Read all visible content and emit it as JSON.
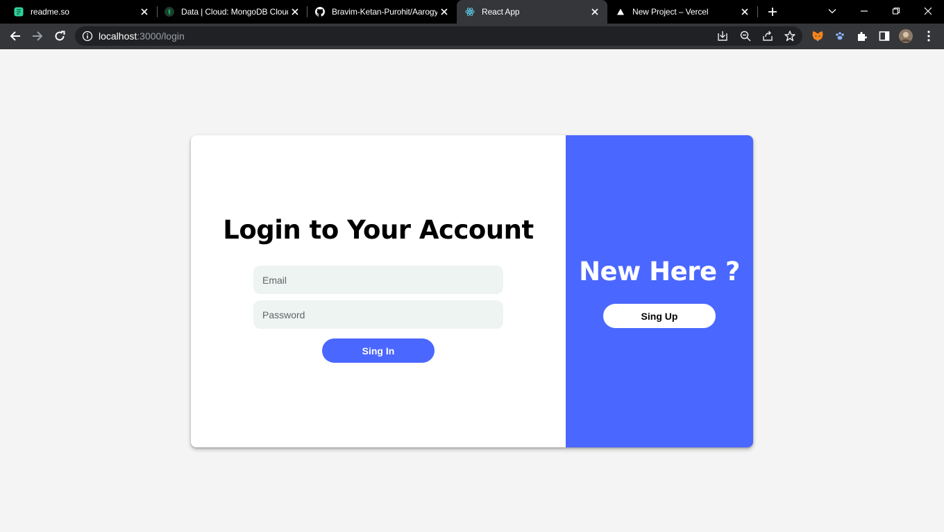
{
  "browser": {
    "tabs": [
      {
        "title": "readme.so",
        "favicon": "readme-so-icon",
        "active": false
      },
      {
        "title": "Data | Cloud: MongoDB Cloud",
        "favicon": "mongodb-leaf-icon",
        "active": false
      },
      {
        "title": "Bravim-Ketan-Purohit/Aarogya",
        "favicon": "github-icon",
        "active": false
      },
      {
        "title": "React App",
        "favicon": "react-icon",
        "active": true
      },
      {
        "title": "New Project – Vercel",
        "favicon": "vercel-triangle-icon",
        "active": false
      }
    ],
    "address": {
      "host": "localhost",
      "path": ":3000/login"
    },
    "colors": {
      "tabstrip": "#000000",
      "toolbar": "#35363a",
      "omnibox": "#202124"
    }
  },
  "page": {
    "login": {
      "title": "Login to Your Account",
      "email_placeholder": "Email",
      "password_placeholder": "Password",
      "signin_label": "Sing In"
    },
    "signup_panel": {
      "title": "New Here ?",
      "signup_label": "Sing Up"
    },
    "colors": {
      "accent": "#4a67ff",
      "input_bg": "#edf4f1",
      "page_bg": "#f4f4f4"
    }
  }
}
